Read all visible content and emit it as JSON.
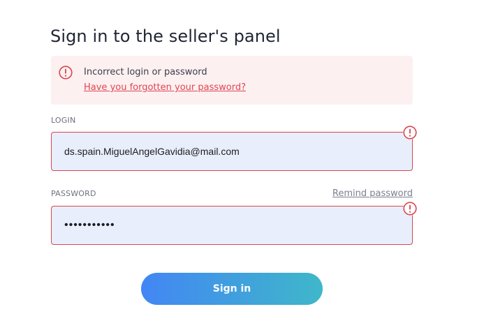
{
  "title": "Sign in to the seller's panel",
  "alert": {
    "message": "Incorrect login or password",
    "link": "Have you forgotten your password?",
    "icon": "exclamation-circle-icon"
  },
  "login": {
    "label": "LOGIN",
    "value": "ds.spain.MiguelAngelGavidia@mail.com",
    "error_icon": "exclamation-circle-icon"
  },
  "password": {
    "label": "PASSWORD",
    "remind_link": "Remind password",
    "value": "•••••••••••",
    "error_icon": "exclamation-circle-icon"
  },
  "signin_button": "Sign in",
  "colors": {
    "error": "#d9454e",
    "alert_bg": "#fdf0f1",
    "input_bg": "#e8eefc",
    "button_gradient_start": "#4286f4",
    "button_gradient_end": "#3fb7c9"
  }
}
